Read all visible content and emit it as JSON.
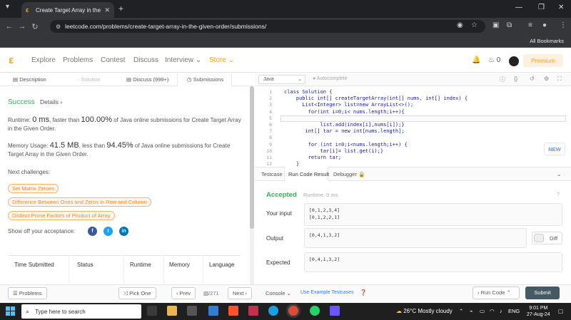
{
  "browser": {
    "tab_title": "Create Target Array in the Given",
    "url": "leetcode.com/problems/create-target-array-in-the-given-order/submissions/",
    "bookmarks_label": "All Bookmarks"
  },
  "nav": {
    "logo": "ε",
    "items": [
      "Explore",
      "Problems",
      "Contest",
      "Discuss",
      "Interview",
      "Store"
    ],
    "points": "0",
    "premium": "Premium"
  },
  "left_tabs": [
    "Description",
    "Solution",
    "Discuss (999+)",
    "Submissions"
  ],
  "result": {
    "status": "Success",
    "details": "Details",
    "runtime_prefix": "Runtime: ",
    "runtime_value": "0 ms",
    "runtime_mid": ", faster than ",
    "runtime_pct": "100.00%",
    "runtime_suffix": " of Java online submissions for Create Target Array in the Given Order.",
    "memory_prefix": "Memory Usage: ",
    "memory_value": "41.5 MB",
    "memory_mid": ", less than ",
    "memory_pct": "94.45%",
    "memory_suffix": " of Java online submissions for Create Target Array in the Given Order."
  },
  "next_challenges_label": "Next challenges:",
  "challenges": [
    "Set Matrix Zeroes",
    "Difference Between Ones and Zeros in Row and Column",
    "Distinct Prime Factors of Product of Array"
  ],
  "share_label": "Show off your acceptance:",
  "table_headers": [
    "Time Submitted",
    "Status",
    "Runtime",
    "Memory",
    "Language"
  ],
  "bottom": {
    "problems": "Problems",
    "pick_one": "Pick One",
    "prev": "Prev",
    "page": "/271",
    "next": "Next",
    "console": "Console",
    "use_example": "Use Example Testcases",
    "run_code": "Run Code",
    "submit": "Submit"
  },
  "editor": {
    "language": "Java",
    "autocomplete": "Autocomplete",
    "line_numbers": [
      "1",
      "2",
      "3",
      "4",
      "5",
      "6",
      "7",
      "8",
      "9",
      "10",
      "11",
      "12"
    ],
    "lines": [
      "class Solution {",
      "    public int[] createTargetArray(int[] nums, int[] index) {",
      "      List<Integer> list=new ArrayList<>();",
      "        for(int i=0;i< nums.length;i++){",
      "",
      "            list.add(index[i],nums[i]);}",
      "       int[] tar = new int[nums.length];",
      "",
      "        for (int i=0;i<nums.length;i++) {",
      "            tar[i]= list.get(i);}",
      "        return tar;",
      "    }"
    ],
    "new_badge": "NEW"
  },
  "result_tabs": [
    "Testcase",
    "Run Code Result",
    "Debugger"
  ],
  "run_result": {
    "status": "Accepted",
    "runtime": "Runtime: 0 ms",
    "your_input_label": "Your input",
    "your_input": [
      "[0,1,2,3,4]",
      "[0,1,2,2,1]"
    ],
    "output_label": "Output",
    "output": "[0,4,1,3,2]",
    "diff": "Diff",
    "expected_label": "Expected",
    "expected": "[0,4,1,3,2]"
  },
  "taskbar": {
    "search_placeholder": "Type here to search",
    "weather": "26°C  Mostly cloudy",
    "lang": "ENG",
    "time": "9:01 PM",
    "date": "27-Aug-24"
  }
}
